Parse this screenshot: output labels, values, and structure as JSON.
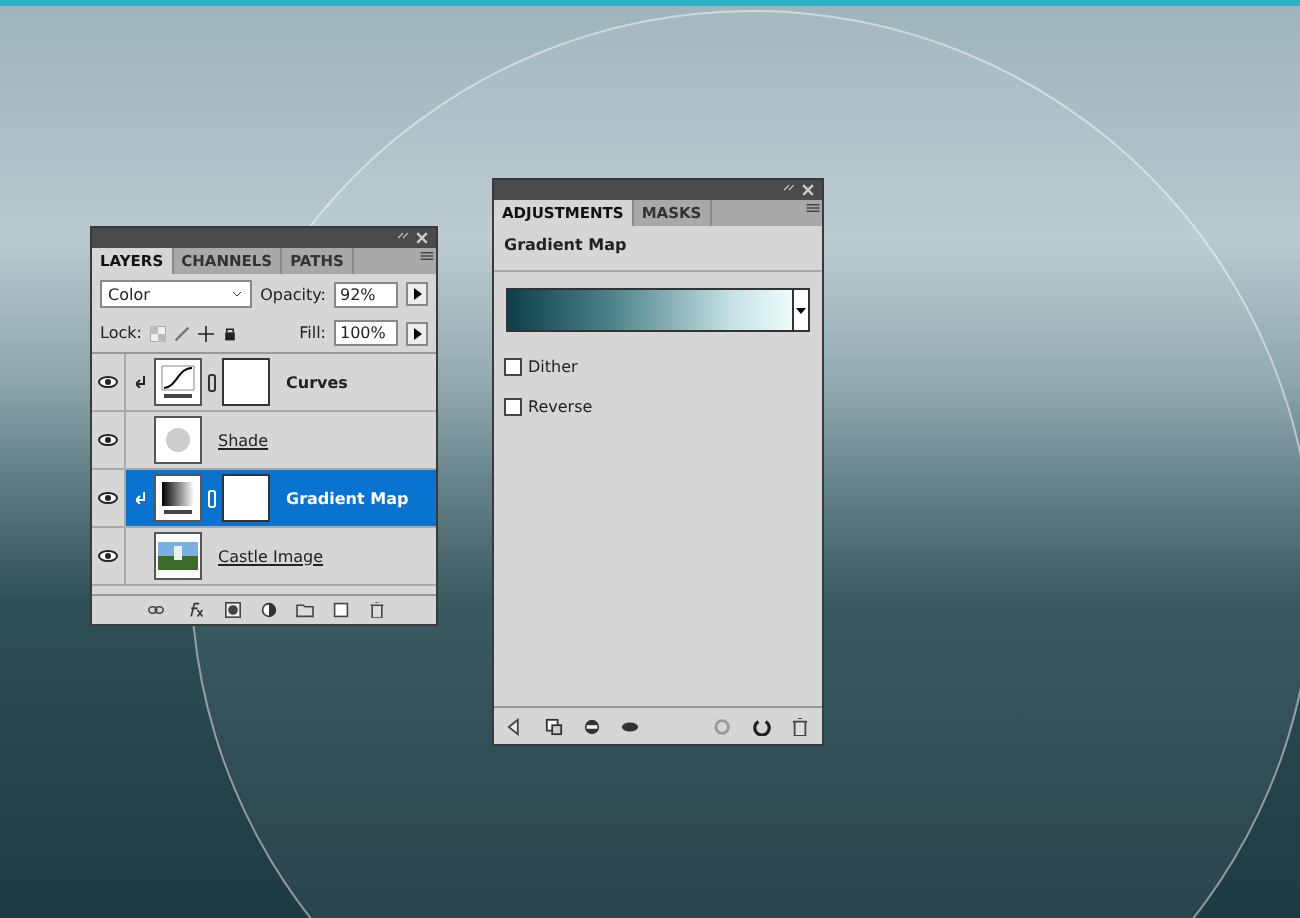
{
  "layers_panel": {
    "tabs": [
      {
        "label": "LAYERS",
        "selected": true
      },
      {
        "label": "CHANNELS",
        "selected": false
      },
      {
        "label": "PATHS",
        "selected": false
      }
    ],
    "blend_mode": "Color",
    "opacity_label": "Opacity:",
    "opacity": "92%",
    "lock_label": "Lock:",
    "fill_label": "Fill:",
    "fill": "100%",
    "layers": [
      {
        "name": "Curves",
        "kind": "curves",
        "clipped": true,
        "selected": false,
        "visible": true
      },
      {
        "name": "Shade",
        "kind": "shade",
        "clipped": false,
        "selected": false,
        "visible": true
      },
      {
        "name": "Gradient Map",
        "kind": "gradient",
        "clipped": true,
        "selected": true,
        "visible": true
      },
      {
        "name": "Castle Image",
        "kind": "photo",
        "clipped": false,
        "selected": false,
        "visible": true
      }
    ]
  },
  "adjustments_panel": {
    "tabs": [
      {
        "label": "ADJUSTMENTS",
        "selected": true
      },
      {
        "label": "MASKS",
        "selected": false
      }
    ],
    "title": "Gradient Map",
    "options": [
      {
        "label": "Dither",
        "checked": false
      },
      {
        "label": "Reverse",
        "checked": false
      }
    ]
  }
}
